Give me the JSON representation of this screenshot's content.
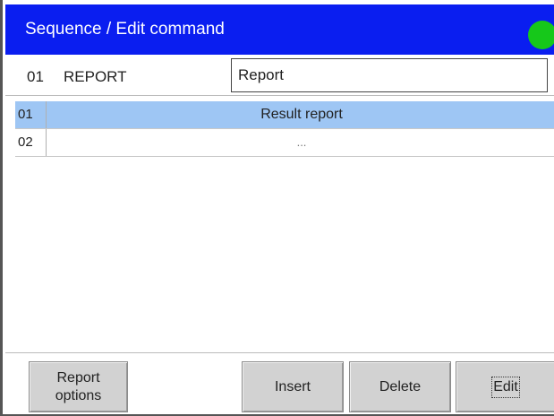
{
  "header": {
    "title": "Sequence / Edit command",
    "status_color": "#16c81a"
  },
  "command": {
    "number": "01",
    "name": "REPORT",
    "value": "Report"
  },
  "list": {
    "rows": [
      {
        "index": "01",
        "label": "Result report",
        "selected": true
      },
      {
        "index": "02",
        "label": "...",
        "selected": false
      }
    ]
  },
  "toolbar": {
    "report_options_label": "Report\noptions",
    "insert_label": "Insert",
    "delete_label": "Delete",
    "edit_label": "Edit"
  },
  "colors": {
    "title_bar": "#0a1ef0",
    "selected_row": "#9ec6f4",
    "button_face": "#d2d2d2"
  }
}
